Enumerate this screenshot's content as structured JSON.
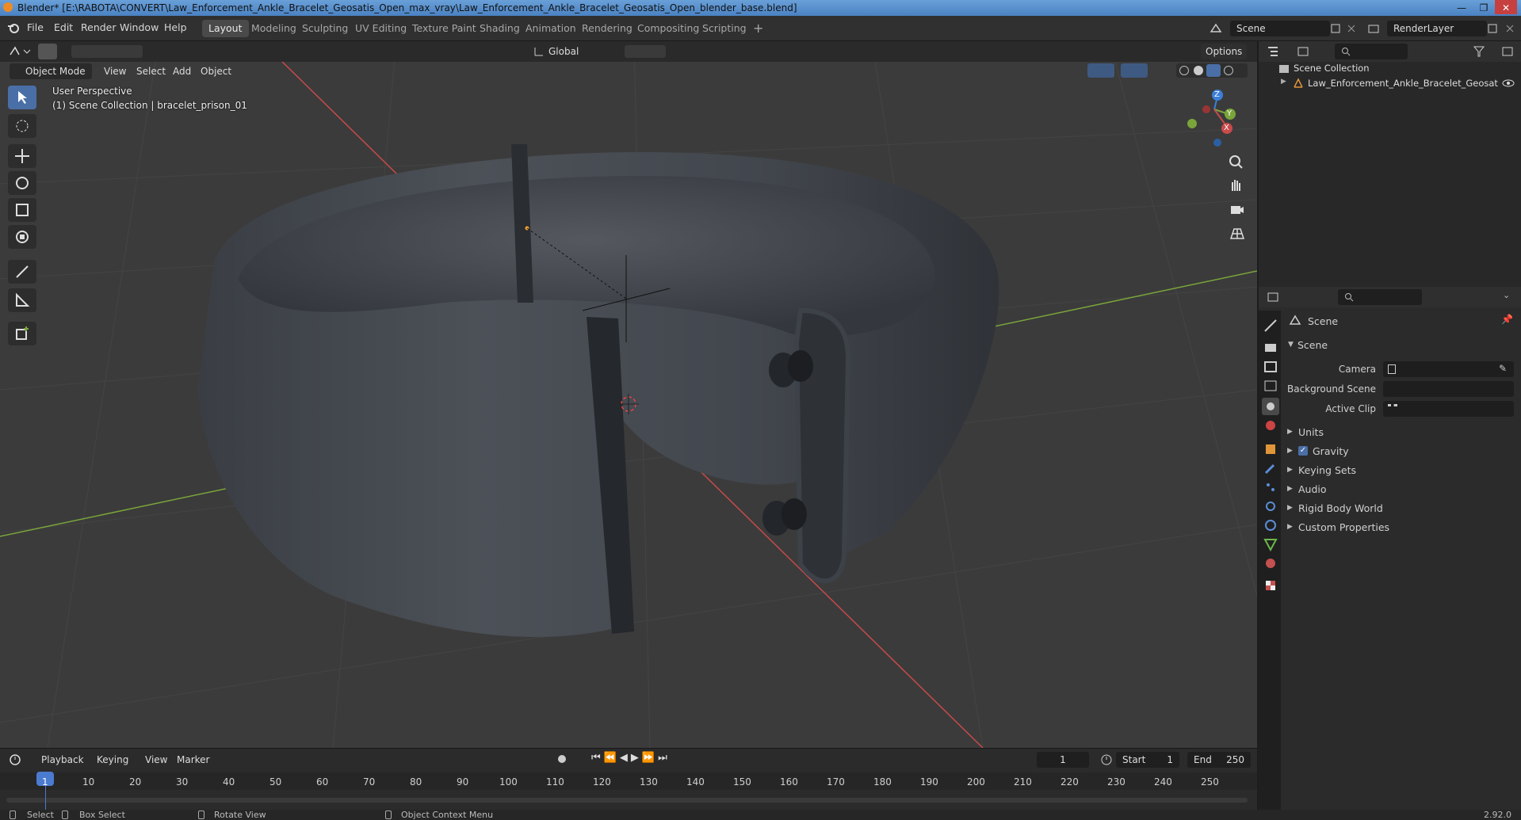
{
  "title_bar": {
    "text": "Blender* [E:\\RABOTA\\CONVERT\\Law_Enforcement_Ankle_Bracelet_Geosatis_Open_max_vray\\Law_Enforcement_Ankle_Bracelet_Geosatis_Open_blender_base.blend]",
    "minimize": "—",
    "maximize": "❐",
    "close": "✕"
  },
  "menu": {
    "items": [
      "File",
      "Edit",
      "Render",
      "Window",
      "Help"
    ],
    "workspaces": [
      "Layout",
      "Modeling",
      "Sculpting",
      "UV Editing",
      "Texture Paint",
      "Shading",
      "Animation",
      "Rendering",
      "Compositing",
      "Scripting"
    ],
    "active_workspace": "Layout",
    "add_tab": "+",
    "scene_name": "Scene",
    "render_layer": "RenderLayer"
  },
  "viewport_header": {
    "mode": "Object Mode",
    "menus": [
      "View",
      "Select",
      "Add",
      "Object"
    ],
    "transform_orientation": "Global",
    "options": "Options"
  },
  "viewport_overlay": {
    "perspective": "User Perspective",
    "collection_info": "(1) Scene Collection | bracelet_prison_01"
  },
  "gizmo": {
    "x": "X",
    "y": "Y",
    "z": "Z"
  },
  "outliner": {
    "root": "Scene Collection",
    "items": [
      "Law_Enforcement_Ankle_Bracelet_Geosatis"
    ]
  },
  "properties": {
    "header": "Scene",
    "section": "Scene",
    "fields": [
      {
        "label": "Camera"
      },
      {
        "label": "Background Scene"
      },
      {
        "label": "Active Clip"
      }
    ],
    "panels": [
      "Units",
      "Gravity",
      "Keying Sets",
      "Audio",
      "Rigid Body World",
      "Custom Properties"
    ],
    "gravity_checked": true
  },
  "timeline": {
    "menus": [
      "Playback",
      "Keying",
      "View",
      "Marker"
    ],
    "current_frame": "1",
    "start_label": "Start",
    "start": "1",
    "end_label": "End",
    "end": "250",
    "ticks": [
      "1",
      "10",
      "20",
      "30",
      "40",
      "50",
      "60",
      "70",
      "80",
      "90",
      "100",
      "110",
      "120",
      "130",
      "140",
      "150",
      "160",
      "170",
      "180",
      "190",
      "200",
      "210",
      "220",
      "230",
      "240",
      "250"
    ]
  },
  "status_bar": {
    "items": [
      "Select",
      "Box Select",
      "Rotate View",
      "Object Context Menu"
    ],
    "version": "2.92.0"
  },
  "colors": {
    "accent": "#4a6fa6",
    "axis_x": "#c84a4a",
    "axis_y": "#7aa53a",
    "axis_z": "#3b7fd8",
    "object": "#3e434b"
  }
}
